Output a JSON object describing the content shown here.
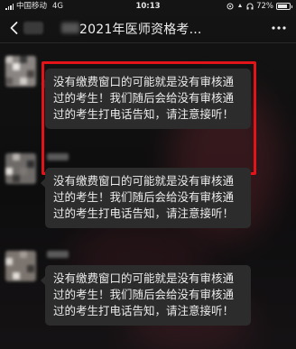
{
  "status_bar": {
    "carrier": "中国移动",
    "network": "4G",
    "time": "10:13",
    "battery_percent": "72%",
    "battery_level": 0.72
  },
  "nav": {
    "title": "2021年医师资格考...",
    "back_icon": "chevron-left-icon",
    "more_icon": "more-dots-icon"
  },
  "messages": [
    {
      "text": "没有缴费窗口的可能就是没有审核通过的考生！我们随后会给没有审核通过的考生打电话告知，请注意接听！",
      "highlighted": true
    },
    {
      "text": "没有缴费窗口的可能就是没有审核通过的考生！我们随后会给没有审核通过的考生打电话告知，请注意接听！",
      "highlighted": false
    },
    {
      "text": "没有缴费窗口的可能就是没有审核通过的考生！我们随后会给没有审核通过的考生打电话告知，请注意接听！",
      "highlighted": false
    }
  ],
  "colors": {
    "background": "#0f0f10",
    "bubble": "#2c2c2c",
    "highlight": "#e2141a",
    "text": "#ececec"
  }
}
